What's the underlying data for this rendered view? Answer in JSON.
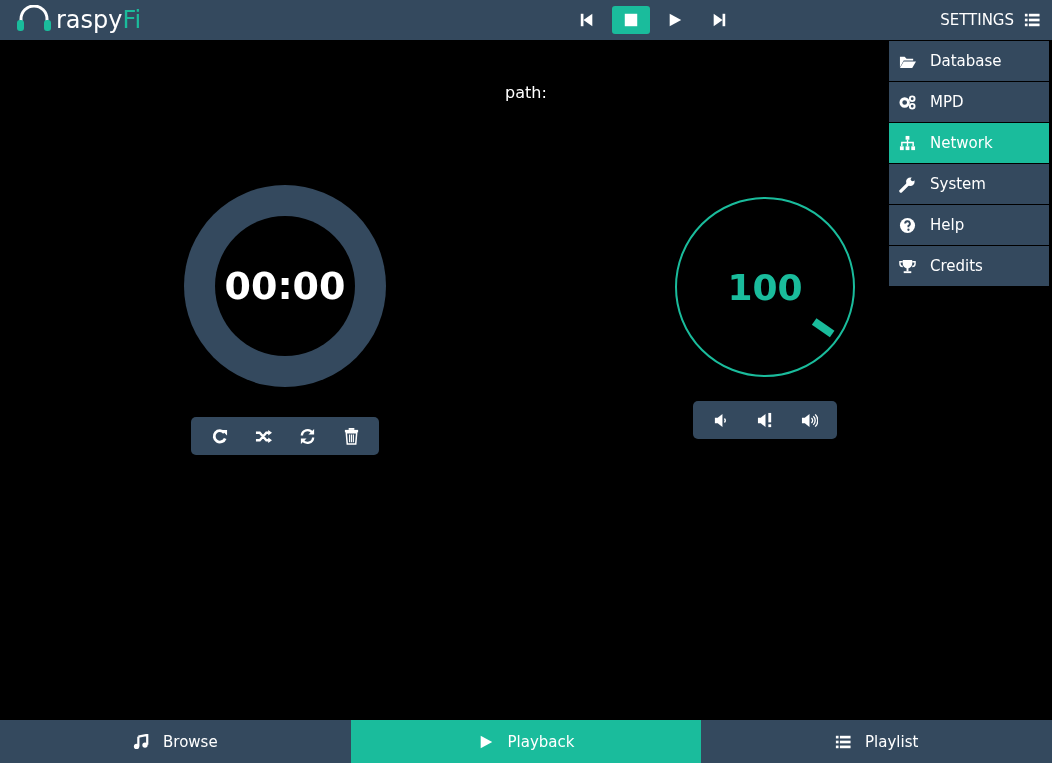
{
  "header": {
    "logo": {
      "word": "raspy",
      "accent": "Fi"
    },
    "transport": [
      {
        "kind": "previous",
        "selected": false
      },
      {
        "kind": "stop",
        "selected": true
      },
      {
        "kind": "play",
        "selected": false
      },
      {
        "kind": "next",
        "selected": false
      }
    ],
    "settings_label": "SETTINGS"
  },
  "settings_menu": [
    {
      "kind": "folder",
      "label": "Database",
      "selected": false
    },
    {
      "kind": "gears",
      "label": "MPD",
      "selected": false
    },
    {
      "kind": "sitemap",
      "label": "Network",
      "selected": true
    },
    {
      "kind": "wrench",
      "label": "System",
      "selected": false
    },
    {
      "kind": "help",
      "label": "Help",
      "selected": false
    },
    {
      "kind": "trophy",
      "label": "Credits",
      "selected": false
    }
  ],
  "path_label": "path:",
  "time_knob": {
    "time": "00:00"
  },
  "playback_controls": [
    {
      "kind": "repeat"
    },
    {
      "kind": "shuffle"
    },
    {
      "kind": "sync"
    },
    {
      "kind": "trash"
    }
  ],
  "volume_knob": {
    "value": "100"
  },
  "volume_controls": [
    {
      "kind": "down"
    },
    {
      "kind": "mute"
    },
    {
      "kind": "up"
    }
  ],
  "footer_tabs": [
    {
      "kind": "music",
      "label": "Browse",
      "selected": false
    },
    {
      "kind": "play",
      "label": "Playback",
      "selected": true
    },
    {
      "kind": "list",
      "label": "Playlist",
      "selected": false
    }
  ]
}
